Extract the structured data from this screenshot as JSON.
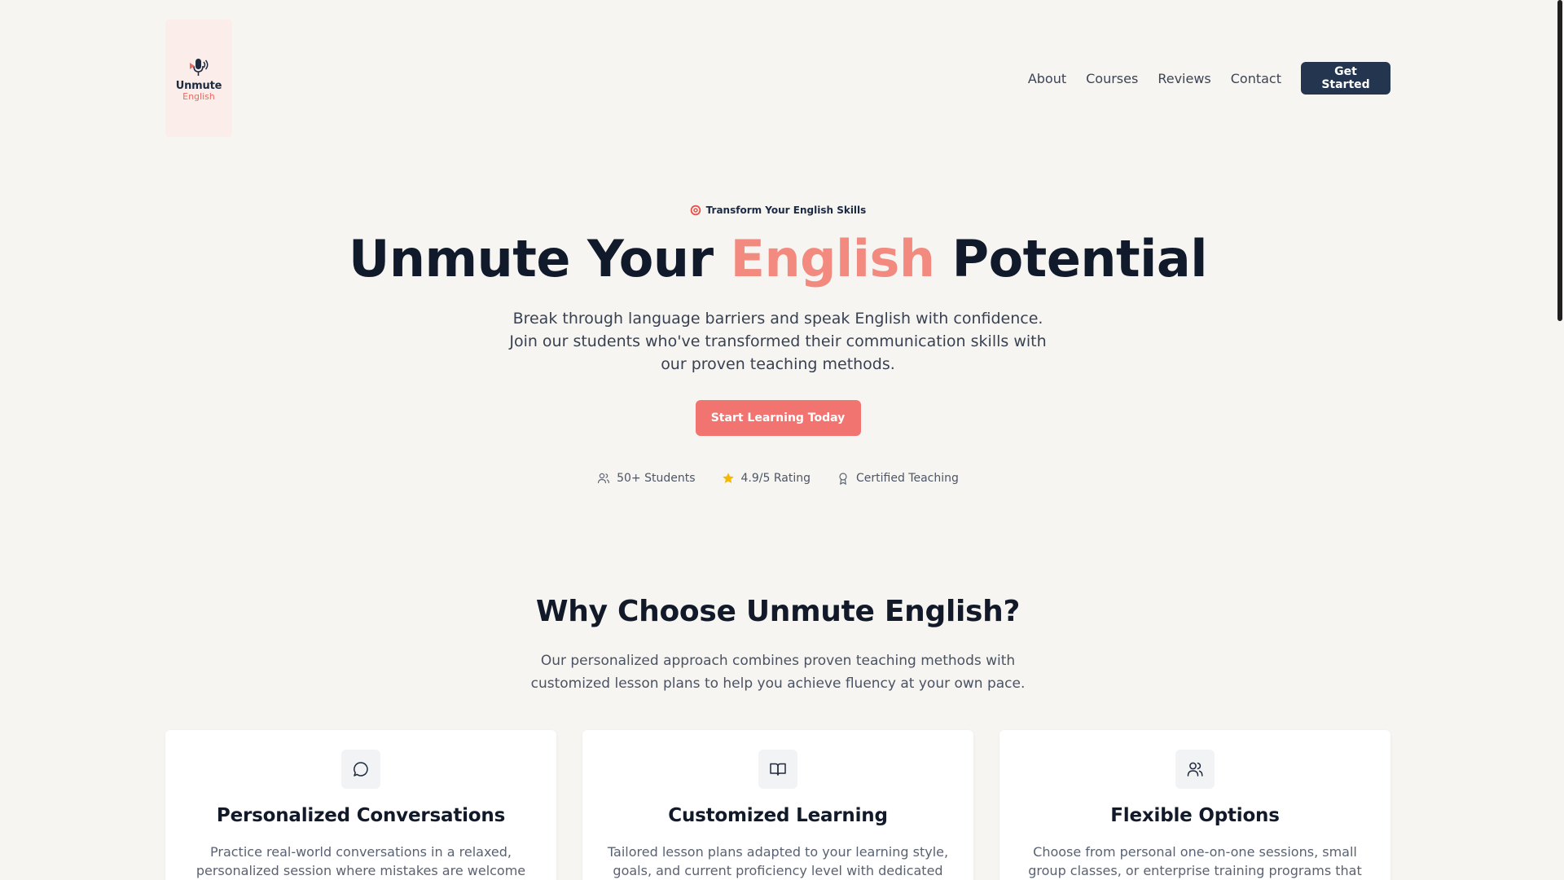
{
  "brand": {
    "word1": "Unmute",
    "word2": "English",
    "accent": "#ea6b63",
    "dark": "#1e2a3e"
  },
  "nav": {
    "links": [
      "About",
      "Courses",
      "Reviews",
      "Contact"
    ],
    "cta": "Get Started"
  },
  "hero": {
    "eyebrow": "Transform Your English Skills",
    "eyebrow_icon": "target-icon",
    "title_pre": "Unmute Your",
    "title_accent": "English",
    "title_post": "Potential",
    "subtitle": "Break through language barriers and speak English with confidence. Join our students who've transformed their communication skills with our proven teaching methods.",
    "cta": "Start Learning Today",
    "stats": [
      {
        "icon": "users-icon",
        "label": "50+ Students"
      },
      {
        "icon": "star-icon",
        "label": "4.9/5 Rating"
      },
      {
        "icon": "award-icon",
        "label": "Certified Teaching"
      }
    ]
  },
  "why": {
    "title": "Why Choose Unmute English?",
    "subtitle": "Our personalized approach combines proven teaching methods with customized lesson plans to help you achieve fluency at your own pace."
  },
  "features": [
    {
      "icon": "chat-bubble-icon",
      "title": "Personalized Conversations",
      "text": "Practice real-world conversations in a relaxed, personalized session where mistakes are welcome and"
    },
    {
      "icon": "open-book-icon",
      "title": "Customized Learning",
      "text": "Tailored lesson plans adapted to your learning style, goals, and current proficiency level with dedicated"
    },
    {
      "icon": "users-icon",
      "title": "Flexible Options",
      "text": "Choose from personal one-on-one sessions, small group classes, or enterprise training programs that fit your"
    }
  ],
  "colors": {
    "background": "#f7f5f1",
    "coral": "#f27470",
    "navy_button": "#23354f",
    "star": "#f5b800"
  }
}
